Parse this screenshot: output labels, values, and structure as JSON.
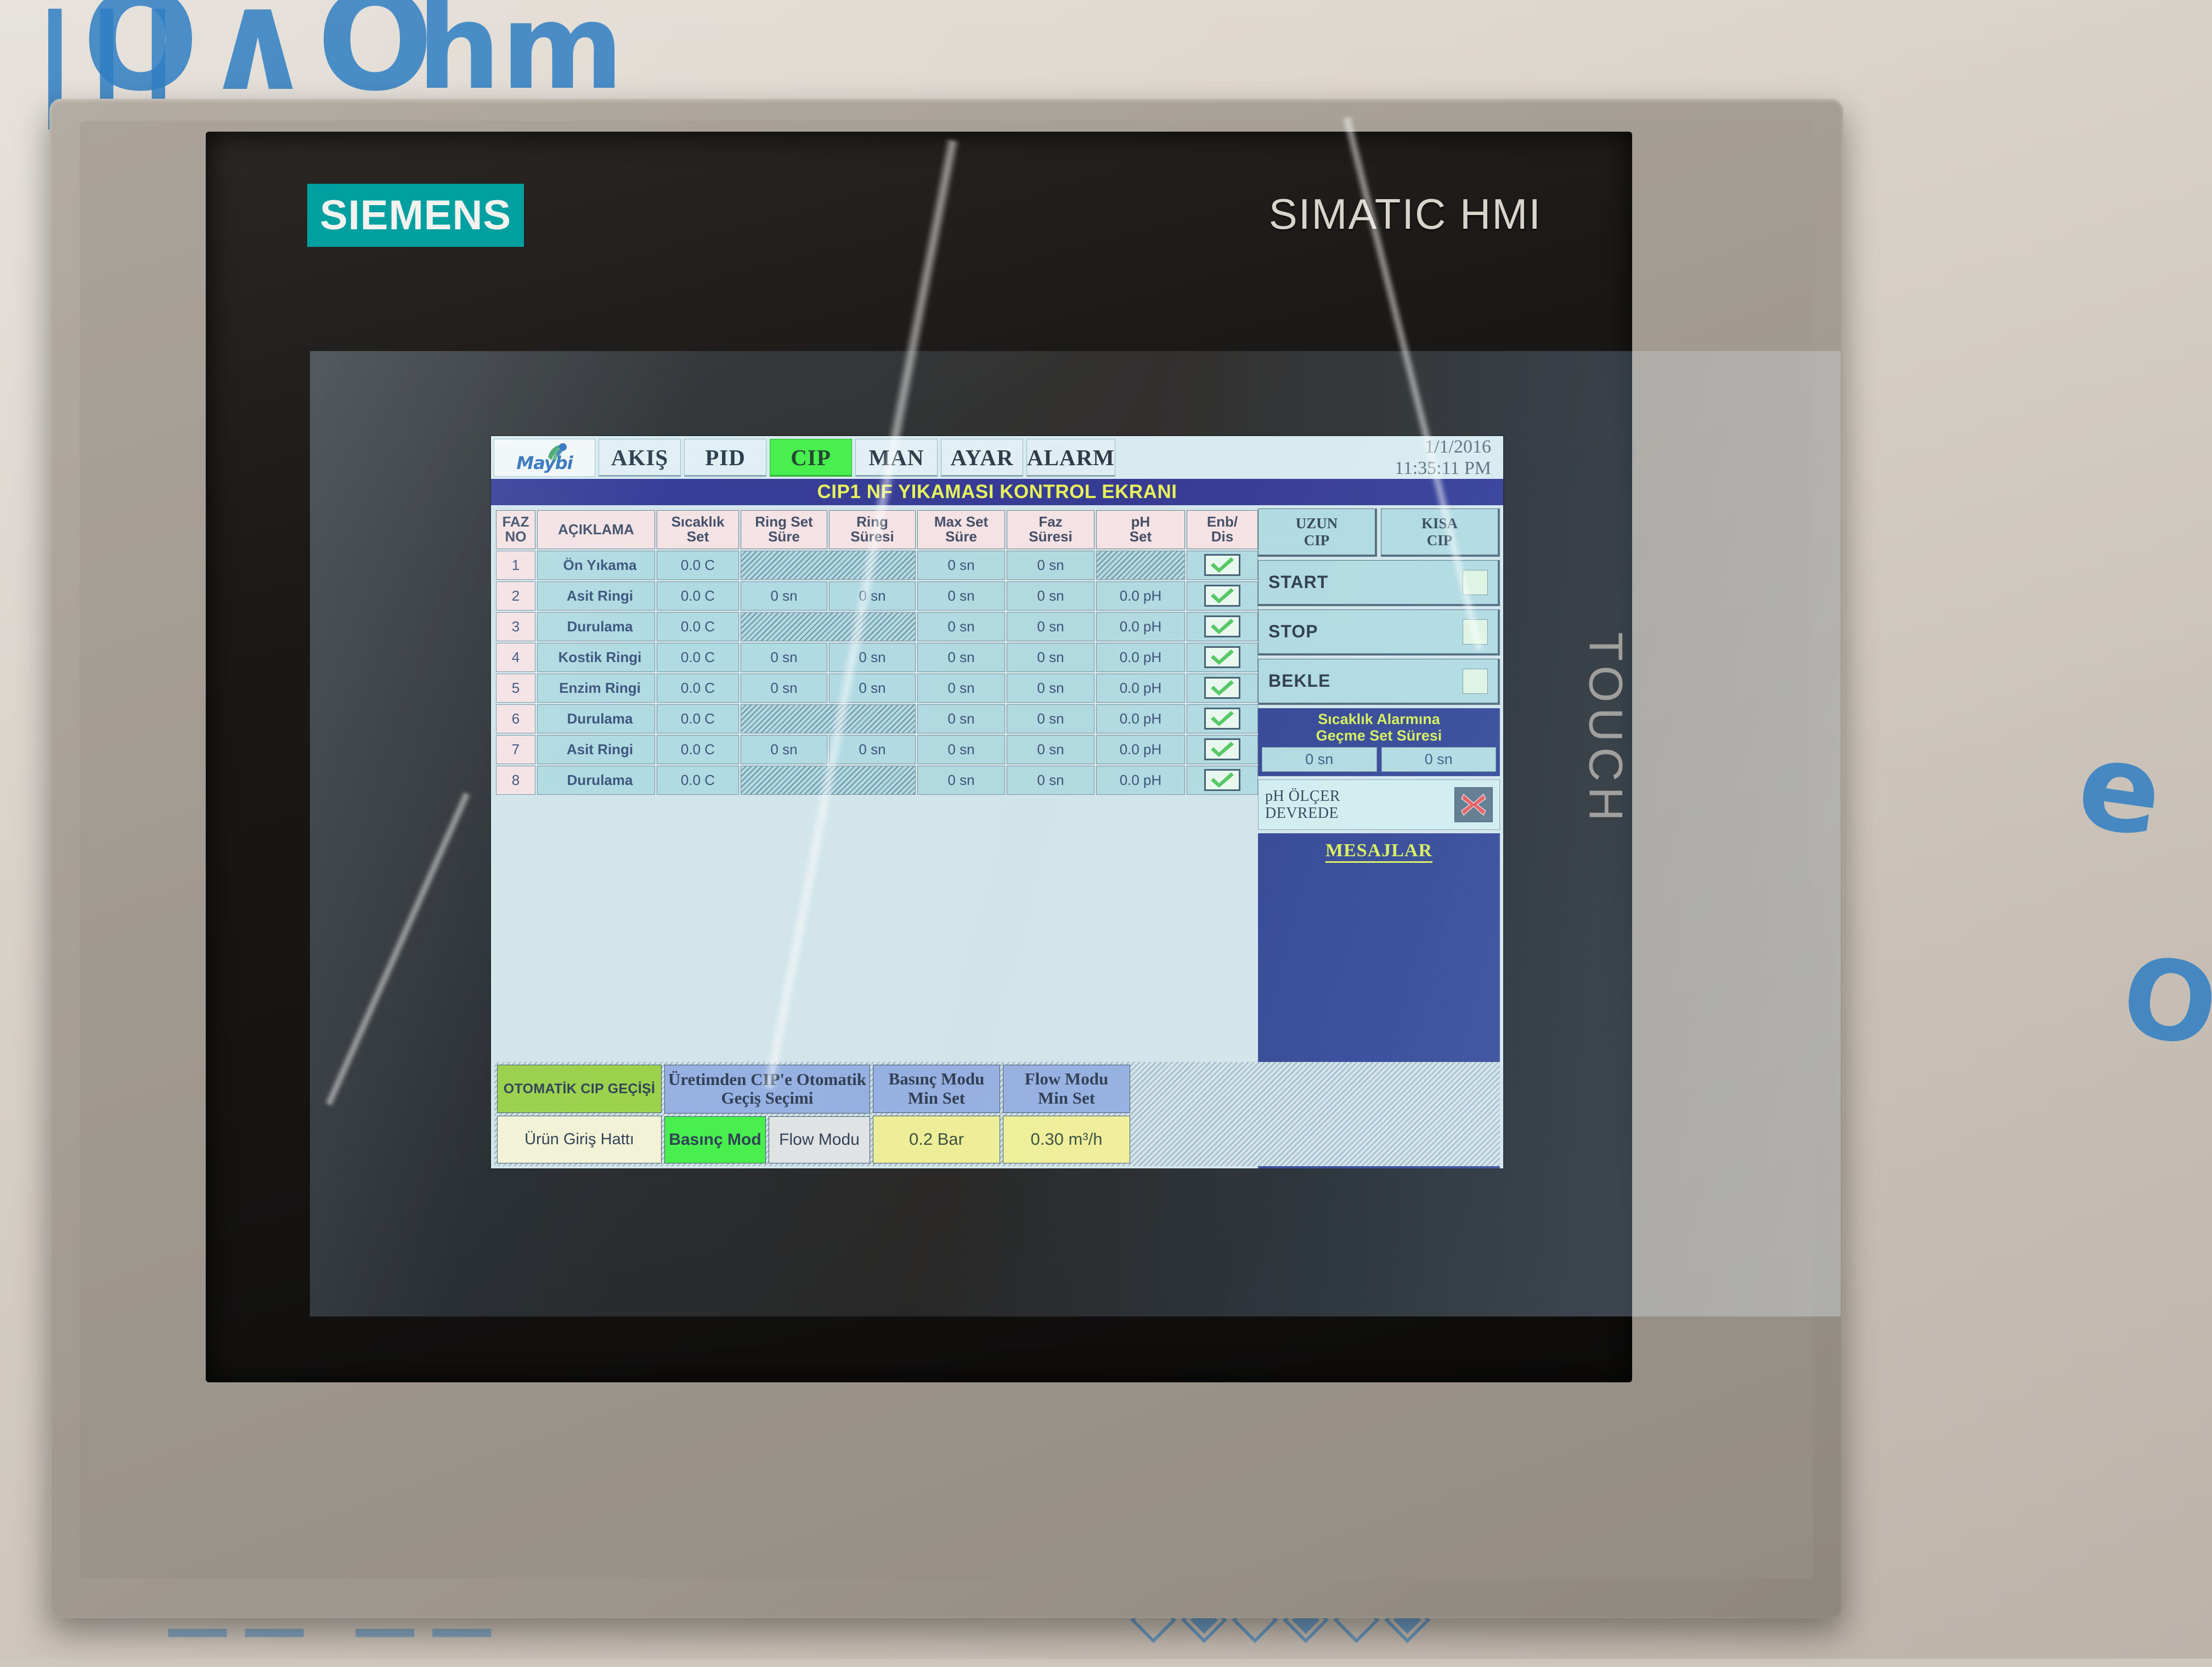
{
  "device": {
    "brand": "SIEMENS",
    "product_line": "SIMATIC HMI",
    "side_text": "TOUCH"
  },
  "nav": {
    "logo_text": "Maybi",
    "tabs": [
      {
        "label": "AKIŞ",
        "active": false
      },
      {
        "label": "PID",
        "active": false
      },
      {
        "label": "CIP",
        "active": true
      },
      {
        "label": "MAN",
        "active": false
      },
      {
        "label": "AYAR",
        "active": false
      },
      {
        "label": "ALARM",
        "active": false
      }
    ],
    "date": "1/1/2016",
    "time": "11:35:11 PM"
  },
  "page_title": "CIP1 NF YIKAMASI KONTROL EKRANI",
  "table": {
    "headers": [
      "FAZ NO",
      "AÇIKLAMA",
      "Sıcaklık Set",
      "Ring Set Süre",
      "Ring Süresi",
      "Max Set Süre",
      "Faz Süresi",
      "pH Set",
      "Enb/ Dis"
    ],
    "headers_multiline": [
      [
        "FAZ",
        "NO"
      ],
      [
        "AÇIKLAMA",
        ""
      ],
      [
        "Sıcaklık",
        "Set"
      ],
      [
        "Ring Set",
        "Süre"
      ],
      [
        "Ring",
        "Süresi"
      ],
      [
        "Max Set",
        "Süre"
      ],
      [
        "Faz",
        "Süresi"
      ],
      [
        "pH",
        "Set"
      ],
      [
        "Enb/",
        "Dis"
      ]
    ],
    "rows": [
      {
        "no": "1",
        "desc": "Ön Yıkama",
        "temp": "0.0 C",
        "ring_set": "",
        "ring": "",
        "ring_merged_hatched": true,
        "max_set": "0 sn",
        "faz": "0 sn",
        "ph": "",
        "ph_hatched": true,
        "enabled": true
      },
      {
        "no": "2",
        "desc": "Asit Ringi",
        "temp": "0.0 C",
        "ring_set": "0 sn",
        "ring": "0 sn",
        "ring_merged_hatched": false,
        "max_set": "0 sn",
        "faz": "0 sn",
        "ph": "0.0 pH",
        "ph_hatched": false,
        "enabled": true
      },
      {
        "no": "3",
        "desc": "Durulama",
        "temp": "0.0 C",
        "ring_set": "",
        "ring": "",
        "ring_merged_hatched": true,
        "max_set": "0 sn",
        "faz": "0 sn",
        "ph": "0.0 pH",
        "ph_hatched": false,
        "enabled": true
      },
      {
        "no": "4",
        "desc": "Kostik Ringi",
        "temp": "0.0 C",
        "ring_set": "0 sn",
        "ring": "0 sn",
        "ring_merged_hatched": false,
        "max_set": "0 sn",
        "faz": "0 sn",
        "ph": "0.0 pH",
        "ph_hatched": false,
        "enabled": true
      },
      {
        "no": "5",
        "desc": "Enzim Ringi",
        "temp": "0.0 C",
        "ring_set": "0 sn",
        "ring": "0 sn",
        "ring_merged_hatched": false,
        "max_set": "0 sn",
        "faz": "0 sn",
        "ph": "0.0 pH",
        "ph_hatched": false,
        "enabled": true
      },
      {
        "no": "6",
        "desc": "Durulama",
        "temp": "0.0 C",
        "ring_set": "",
        "ring": "",
        "ring_merged_hatched": true,
        "max_set": "0 sn",
        "faz": "0 sn",
        "ph": "0.0 pH",
        "ph_hatched": false,
        "enabled": true
      },
      {
        "no": "7",
        "desc": "Asit Ringi",
        "temp": "0.0 C",
        "ring_set": "0 sn",
        "ring": "0 sn",
        "ring_merged_hatched": false,
        "max_set": "0 sn",
        "faz": "0 sn",
        "ph": "0.0 pH",
        "ph_hatched": false,
        "enabled": true
      },
      {
        "no": "8",
        "desc": "Durulama",
        "temp": "0.0 C",
        "ring_set": "",
        "ring": "",
        "ring_merged_hatched": true,
        "max_set": "0 sn",
        "faz": "0 sn",
        "ph": "0.0 pH",
        "ph_hatched": false,
        "enabled": true
      }
    ]
  },
  "side_panel": {
    "uzun_cip": {
      "line1": "UZUN",
      "line2": "CIP"
    },
    "kisa_cip": {
      "line1": "KISA",
      "line2": "CIP"
    },
    "start": "START",
    "stop": "STOP",
    "bekle": "BEKLE",
    "alarm_set": {
      "title_line1": "Sıcaklık Alarmına",
      "title_line2": "Geçme Set Süresi",
      "value1": "0 sn",
      "value2": "0 sn"
    },
    "ph_meter": {
      "line1": "pH  ÖLÇER",
      "line2": "DEVREDE",
      "state": "off"
    },
    "messages_title": "MESAJLAR"
  },
  "bottom": {
    "otomatik_cip_gecisi": "OTOMATİK CIP GEÇİŞİ",
    "urun_giris_hatti": "Ürün Giriş Hattı",
    "uretim_cip_title_l1": "Üretimden CIP'e Otomatik",
    "uretim_cip_title_l2": "Geçiş Seçimi",
    "basinc_mod": "Basınç Mod",
    "flow_modu": "Flow Modu",
    "basinc_min_l1": "Basınç Modu",
    "basinc_min_l2": "Min Set",
    "basinc_min_value": "0.2 Bar",
    "flow_min_l1": "Flow Modu",
    "flow_min_l2": "Min Set",
    "flow_min_value": "0.30 m³/h"
  },
  "colors": {
    "active_tab": "#2ef02e",
    "title_bar_bg": "#1b1f86",
    "title_bar_text": "#e8f441",
    "table_cell_bg": "#a9d8e0",
    "header_cell_bg": "#f7e2e4",
    "siemens_teal": "#00a0a0",
    "check_green": "#3fc24a",
    "x_red": "#e0413e"
  }
}
